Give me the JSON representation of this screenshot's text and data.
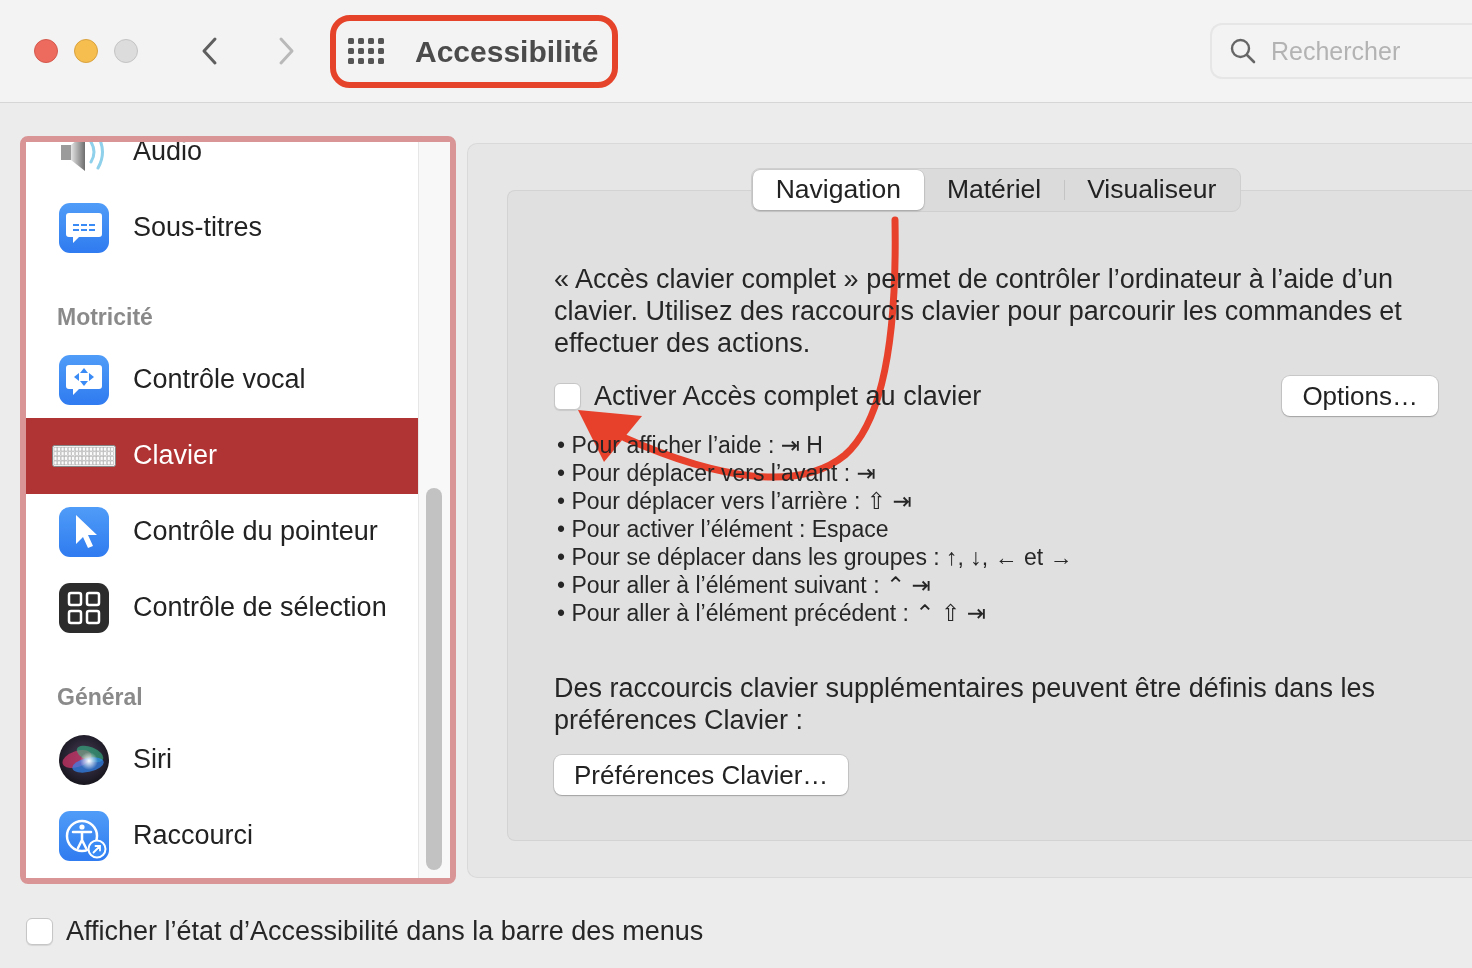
{
  "window": {
    "title": "Accessibilité",
    "buttons": [
      {
        "kind": "close",
        "disabled": false
      },
      {
        "kind": "minimize",
        "disabled": false
      },
      {
        "kind": "zoom",
        "disabled": true
      }
    ]
  },
  "toolbar": {
    "navigation_buttons": [
      {
        "kind": "back",
        "disabled": false
      },
      {
        "kind": "forward",
        "disabled": true
      }
    ],
    "search": {
      "placeholder": "Rechercher"
    }
  },
  "sidebar": {
    "sections": [
      {
        "items": [
          {
            "label": "Audio",
            "selected": false
          },
          {
            "label": "Sous-titres",
            "selected": false
          }
        ]
      },
      {
        "title": "Motricité",
        "items": [
          {
            "label": "Contrôle vocal",
            "selected": false
          },
          {
            "label": "Clavier",
            "selected": true
          },
          {
            "label": "Contrôle du pointeur",
            "selected": false
          },
          {
            "label": "Contrôle de sélection",
            "selected": false
          }
        ]
      },
      {
        "title": "Général",
        "items": [
          {
            "label": "Siri",
            "selected": false
          },
          {
            "label": "Raccourci",
            "selected": false
          }
        ]
      }
    ]
  },
  "tabs": [
    {
      "label": "Navigation",
      "selected": true
    },
    {
      "label": "Matériel",
      "selected": false
    },
    {
      "label": "Visualiseur",
      "selected": false
    }
  ],
  "navigation_pane": {
    "description": "« Accès clavier complet » permet de contrôler l’ordinateur à l’aide d’un clavier. Utilisez des raccourcis clavier pour parcourir les commandes et effectuer des actions.",
    "full_keyboard_access": {
      "label": "Activer Accès complet au clavier",
      "checked": false
    },
    "options_button": "Options…",
    "shortcuts": [
      "• Pour afficher l’aide : ⇥ H",
      "• Pour déplacer vers l’avant : ⇥",
      "• Pour déplacer vers l’arrière : ⇧ ⇥",
      "• Pour activer l’élément : Espace",
      "• Pour se déplacer dans les groupes : ↑, ↓, ← et →",
      "• Pour aller à l’élément suivant : ⌃ ⇥",
      "• Pour aller à l’élément précédent : ⌃ ⇧ ⇥"
    ],
    "note": "Des raccourcis clavier supplémentaires peuvent être définis dans les préférences Clavier :",
    "preferences_button": "Préférences Clavier…"
  },
  "footer": {
    "show_status_in_menu_bar": {
      "label": "Afficher l’état d’Accessibilité dans la barre des menus",
      "checked": false
    }
  }
}
